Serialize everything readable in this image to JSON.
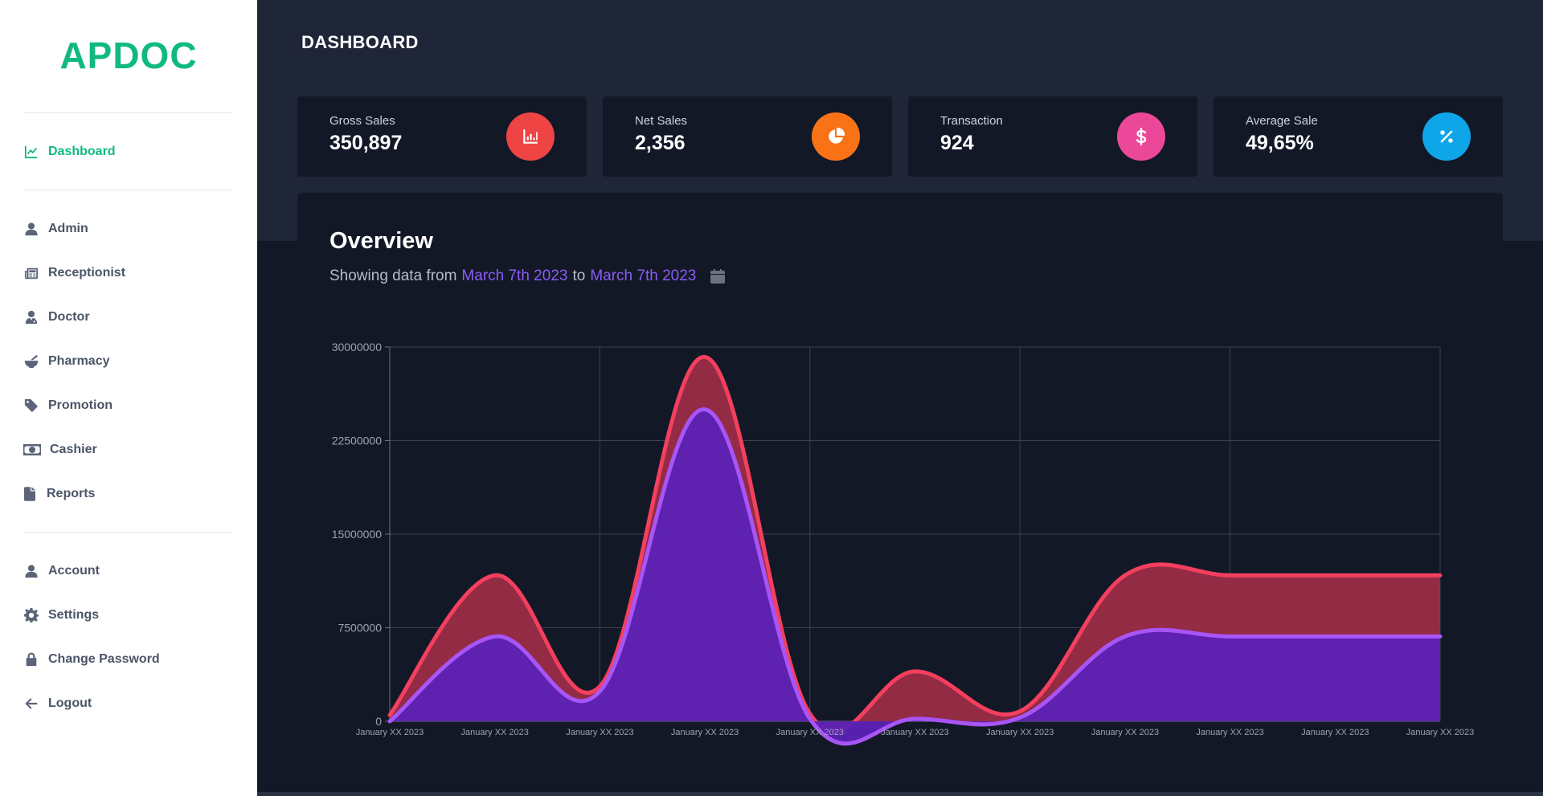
{
  "app": {
    "logo": "APDOC",
    "brand_color": "#10b981"
  },
  "sidebar": {
    "dashboard": {
      "label": "Dashboard",
      "icon": "chart-line-icon"
    },
    "items": [
      {
        "label": "Admin",
        "icon": "user-icon"
      },
      {
        "label": "Receptionist",
        "icon": "newspaper-icon"
      },
      {
        "label": "Doctor",
        "icon": "doctor-icon"
      },
      {
        "label": "Pharmacy",
        "icon": "mortar-pestle-icon"
      },
      {
        "label": "Promotion",
        "icon": "tag-icon"
      },
      {
        "label": "Cashier",
        "icon": "money-bill-icon"
      },
      {
        "label": "Reports",
        "icon": "file-icon"
      }
    ],
    "footer_items": [
      {
        "label": "Account",
        "icon": "user-icon"
      },
      {
        "label": "Settings",
        "icon": "gear-icon"
      },
      {
        "label": "Change Password",
        "icon": "lock-icon"
      },
      {
        "label": "Logout",
        "icon": "arrow-left-icon"
      }
    ]
  },
  "header": {
    "title": "DASHBOARD"
  },
  "stats": [
    {
      "label": "Gross Sales",
      "value": "350,897",
      "icon": "bar-chart-icon",
      "color": "#ef4444"
    },
    {
      "label": "Net Sales",
      "value": "2,356",
      "icon": "pie-chart-icon",
      "color": "#f97316"
    },
    {
      "label": "Transaction",
      "value": "924",
      "icon": "dollar-icon",
      "color": "#ec4899"
    },
    {
      "label": "Average Sale",
      "value": "49,65%",
      "icon": "percent-icon",
      "color": "#0ea5e9"
    }
  ],
  "overview": {
    "title": "Overview",
    "subtitle_prefix": "Showing data from",
    "from_date": "March 7th 2023",
    "connector": "to",
    "to_date": "March 7th 2023",
    "calendar_icon": "calendar-icon"
  },
  "chart_data": {
    "type": "area",
    "x": [
      "January XX 2023",
      "January XX 2023",
      "January XX 2023",
      "January XX 2023",
      "January XX 2023",
      "January XX 2023",
      "January XX 2023",
      "January XX 2023",
      "January XX 2023",
      "January XX 2023",
      "January XX 2023"
    ],
    "series": [
      {
        "values": [
          500000,
          11700000,
          2800000,
          29200000,
          600000,
          4000000,
          800000,
          11700000,
          11700000,
          11700000,
          11700000
        ],
        "color": "#f43f5e",
        "fill": "#9b2c47"
      },
      {
        "values": [
          0,
          6800000,
          2400000,
          25000000,
          200000,
          200000,
          300000,
          6800000,
          6800000,
          6800000,
          6800000
        ],
        "color": "#a855f7",
        "fill": "#5b21b6"
      }
    ],
    "y_ticks": [
      "0",
      "7500000",
      "15000000",
      "22500000",
      "30000000"
    ],
    "ylim": [
      0,
      30000000
    ],
    "grid": true
  }
}
